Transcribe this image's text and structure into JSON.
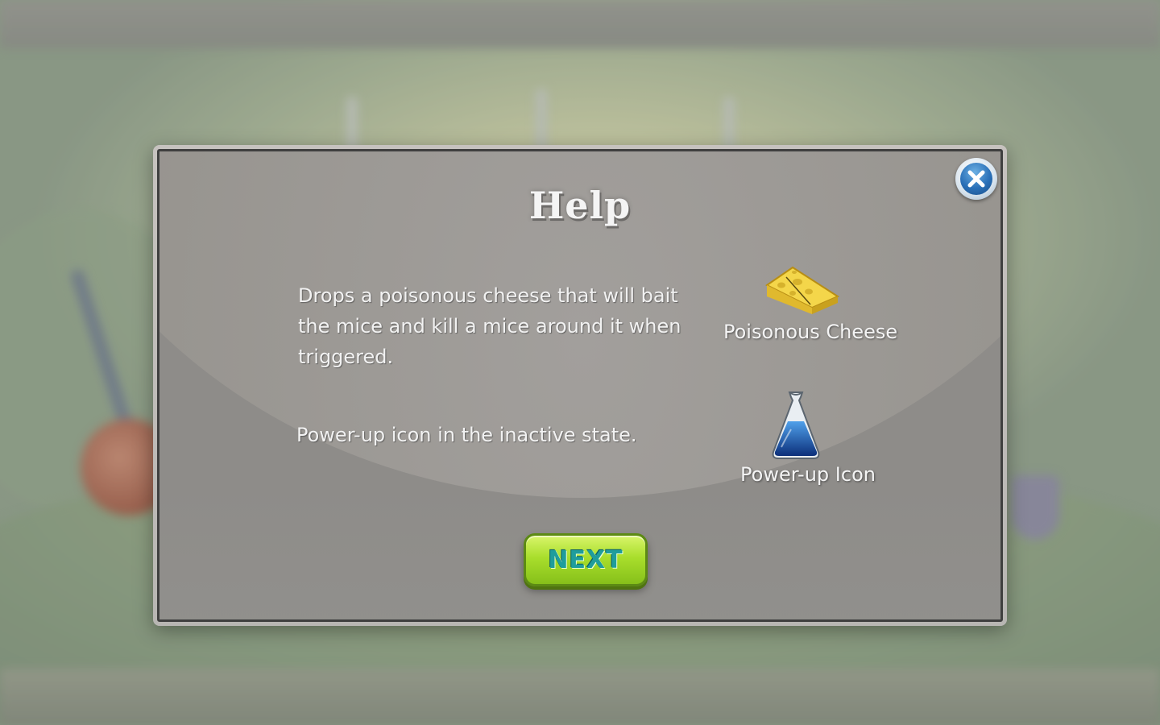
{
  "dialog": {
    "title": "Help",
    "close_icon": "close-x-icon",
    "items": [
      {
        "description": "Drops  a  poisonous cheese that will bait the mice and kill a mice around it when triggered.",
        "label": "Poisonous Cheese",
        "icon": "cheese-icon"
      },
      {
        "description": "Power-up icon in the inactive state.",
        "label": "Power-up Icon",
        "icon": "flask-icon"
      }
    ],
    "next_label": "NEXT"
  },
  "colors": {
    "next_button": "#a9de2c",
    "next_text": "#1f9d9c",
    "close_button": "#2a70b8",
    "flask_liquid": "#1a5fc2",
    "cheese": "#f4d64a"
  }
}
